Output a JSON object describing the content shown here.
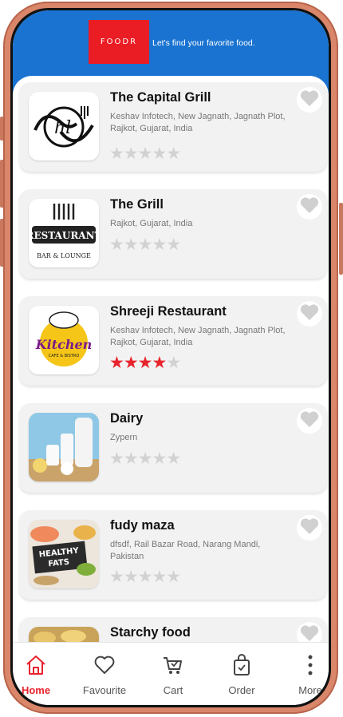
{
  "header": {
    "logo_text": "FOODR",
    "tagline": "Let's find your favorite food.",
    "brand_color": "#ea1c24",
    "header_color": "#1a73d1"
  },
  "restaurants": [
    {
      "name": "The Capital Grill",
      "address": "Keshav Infotech, New Jagnath, Jagnath Plot, Rajkot, Gujarat, India",
      "rating": 0,
      "logo": "hl-restaurant-logo"
    },
    {
      "name": "The Grill",
      "address": "Rajkot, Gujarat, India",
      "rating": 0,
      "logo": "restaurant-bar-lounge-logo"
    },
    {
      "name": "Shreeji Restaurant",
      "address": "Keshav Infotech, New Jagnath, Jagnath Plot, Rajkot, Gujarat, India",
      "rating": 4,
      "logo": "kitchen-chef-logo"
    },
    {
      "name": "Dairy",
      "address": "Zypern",
      "rating": 0,
      "logo": "dairy-photo"
    },
    {
      "name": "fudy maza",
      "address": "dfsdf, Rail Bazar Road, Narang Mandi, Pakistan",
      "rating": 0,
      "logo": "healthy-fats-photo"
    },
    {
      "name": "Starchy food",
      "address": "",
      "rating": 0,
      "logo": "pasta-photo"
    }
  ],
  "nav": {
    "home": "Home",
    "favourite": "Favourite",
    "cart": "Cart",
    "order": "Order",
    "more": "More",
    "active": "home",
    "accent": "#e8232c"
  }
}
